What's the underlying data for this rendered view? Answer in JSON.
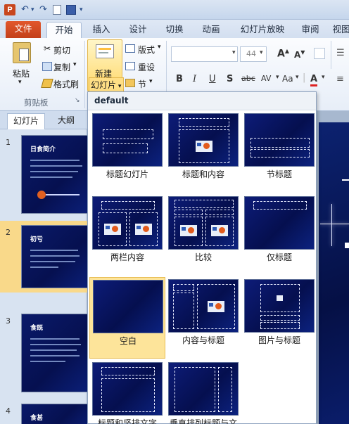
{
  "titlebar": {
    "app_icon_label": "P",
    "quick_access": [
      "undo-icon",
      "redo-icon",
      "new-icon",
      "save-icon",
      "customize-icon"
    ]
  },
  "tabs": [
    {
      "label": "文件"
    },
    {
      "label": "开始"
    },
    {
      "label": "插入"
    },
    {
      "label": "设计"
    },
    {
      "label": "切换"
    },
    {
      "label": "动画"
    },
    {
      "label": "幻灯片放映"
    },
    {
      "label": "审阅"
    },
    {
      "label": "视图"
    }
  ],
  "ribbon": {
    "clipboard": {
      "paste": "粘贴",
      "cut": "剪切",
      "copy": "复制",
      "format_painter": "格式刷",
      "caption": "剪贴板"
    },
    "slides": {
      "new_slide_line1": "新建",
      "new_slide_line2": "幻灯片",
      "layout": "版式",
      "reset": "重设",
      "section": "节"
    },
    "font": {
      "font_name": "",
      "font_size": "44"
    }
  },
  "left_panel": {
    "tabs": [
      "幻灯片",
      "大纲"
    ],
    "slides": [
      {
        "number": "1",
        "title": "日食简介"
      },
      {
        "number": "2",
        "title": "初亏"
      },
      {
        "number": "3",
        "title": "食既"
      },
      {
        "number": "4",
        "title": "食甚"
      }
    ]
  },
  "gallery": {
    "header": "default",
    "items": [
      {
        "label": "标题幻灯片"
      },
      {
        "label": "标题和内容"
      },
      {
        "label": "节标题"
      },
      {
        "label": "两栏内容"
      },
      {
        "label": "比较"
      },
      {
        "label": "仅标题"
      },
      {
        "label": "空白"
      },
      {
        "label": "内容与标题"
      },
      {
        "label": "图片与标题"
      },
      {
        "label": "标题和竖排文字"
      },
      {
        "label": "垂直排列标题与文"
      }
    ],
    "selected_index": 6
  },
  "colors": {
    "file_tab": "#c3401a",
    "slide_bg": "#050f4f",
    "selection": "#fde49a"
  }
}
